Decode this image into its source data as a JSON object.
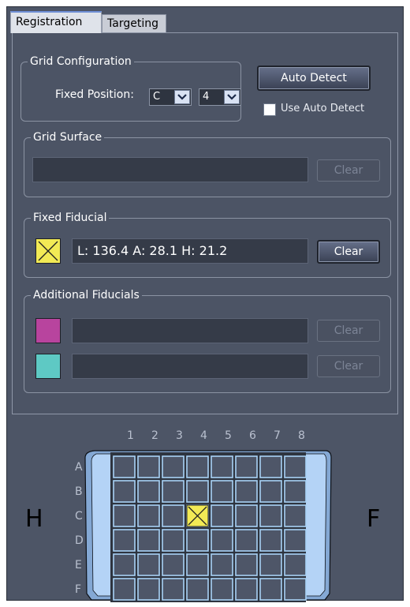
{
  "tabs": [
    {
      "label": "Registration",
      "active": true
    },
    {
      "label": "Targeting",
      "active": false
    }
  ],
  "grid_configuration": {
    "legend": "Grid Configuration",
    "fixed_position_label": "Fixed Position:",
    "row_value": "C",
    "column_value": "4",
    "auto_detect_label": "Auto Detect",
    "use_auto_detect_label": "Use Auto Detect",
    "use_auto_detect_checked": false
  },
  "grid_surface": {
    "legend": "Grid Surface",
    "value": "",
    "clear_label": "Clear",
    "clear_enabled": false
  },
  "fixed_fiducial": {
    "legend": "Fixed Fiducial",
    "color": "#f2ea55",
    "value": "L: 136.4  A: 28.1  H: 21.2",
    "clear_label": "Clear",
    "clear_enabled": true
  },
  "additional_fiducials": {
    "legend": "Additional Fiducials",
    "items": [
      {
        "color": "#b8449e",
        "value": "",
        "clear_label": "Clear",
        "clear_enabled": false
      },
      {
        "color": "#5ec9c4",
        "value": "",
        "clear_label": "Clear",
        "clear_enabled": false
      }
    ]
  },
  "grid_view": {
    "columns": [
      "1",
      "2",
      "3",
      "4",
      "5",
      "6",
      "7",
      "8"
    ],
    "rows": [
      "A",
      "B",
      "C",
      "D",
      "E",
      "F"
    ],
    "marked_cell": {
      "row": "C",
      "column": "4"
    },
    "left_side_label": "H",
    "right_side_label": "F",
    "frame_color": "#9ec3ee",
    "grid_line_color": "#a8d2f6"
  }
}
